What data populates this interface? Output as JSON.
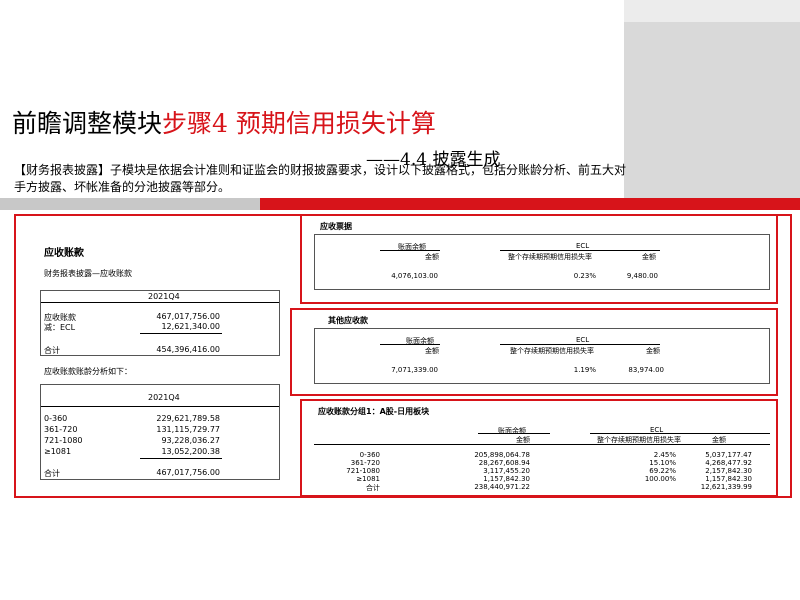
{
  "header": {
    "title_main": "前瞻调整模块",
    "title_step": "步骤4 预期信用损失计算",
    "subtitle": "——4.4 披露生成",
    "description": "【财务报表披露】子模块是依据会计准则和证监会的财报披露要求，设计以下披露格式，包括分账龄分析、前五大对手方披露、坏帐准备的分池披露等部分。"
  },
  "receivables": {
    "heading": "应收账款",
    "caption": "财务报表披露—应收账款",
    "period": "2021Q4",
    "rows": [
      {
        "label": "应收账款",
        "value": "467,017,756.00"
      },
      {
        "label": "减：ECL",
        "value": "12,621,340.00"
      },
      {
        "label": "合计",
        "value": "454,396,416.00"
      }
    ],
    "aging_caption": "应收账款账龄分析如下：",
    "aging_period": "2021Q4",
    "aging_rows": [
      {
        "label": "0-360",
        "value": "229,621,789.58"
      },
      {
        "label": "361-720",
        "value": "131,115,729.77"
      },
      {
        "label": "721-1080",
        "value": "93,228,036.27"
      },
      {
        "label": "≥1081",
        "value": "13,052,200.38"
      },
      {
        "label": "合计",
        "value": "467,017,756.00"
      }
    ]
  },
  "notes_receivable": {
    "heading": "应收票据",
    "col_book": "账面余额",
    "col_ecl": "ECL",
    "sub_amount": "金额",
    "sub_rate": "整个存续期预期信用损失率",
    "sub_amount2": "金额",
    "book_value": "4,076,103.00",
    "rate": "0.23%",
    "ecl_amount": "9,480.00"
  },
  "other_receivables": {
    "heading": "其他应收款",
    "col_book": "账面余额",
    "col_ecl": "ECL",
    "sub_amount": "金额",
    "sub_rate": "整个存续期预期信用损失率",
    "sub_amount2": "金额",
    "book_value": "7,071,339.00",
    "rate": "1.19%",
    "ecl_amount": "83,974.00"
  },
  "pool_a": {
    "heading": "应收账款分组1：A股-日用板块",
    "col_book": "账面余额",
    "col_ecl": "ECL",
    "sub_amount": "金额",
    "sub_rate": "整个存续期预期信用损失率",
    "sub_amount2": "金额",
    "rows": [
      {
        "label": "0-360",
        "book": "205,898,064.78",
        "rate": "2.45%",
        "ecl": "5,037,177.47"
      },
      {
        "label": "361-720",
        "book": "28,267,608.94",
        "rate": "15.10%",
        "ecl": "4,268,477.92"
      },
      {
        "label": "721-1080",
        "book": "3,117,455.20",
        "rate": "69.22%",
        "ecl": "2,157,842.30"
      },
      {
        "label": "≥1081",
        "book": "1,157,842.30",
        "rate": "100.00%",
        "ecl": "1,157,842.30"
      },
      {
        "label": "合计",
        "book": "238,440,971.22",
        "rate": "",
        "ecl": "12,621,339.99"
      }
    ]
  }
}
